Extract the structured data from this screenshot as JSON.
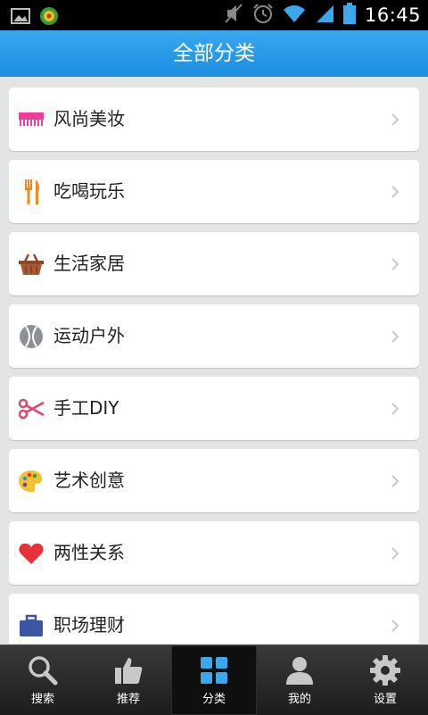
{
  "status_bar": {
    "time": "16:45",
    "icons": [
      "gallery-icon",
      "android-app-icon",
      "mute-icon",
      "alarm-icon",
      "wifi-icon",
      "signal-icon",
      "battery-icon"
    ]
  },
  "header": {
    "title": "全部分类"
  },
  "categories": [
    {
      "label": "风尚美妆",
      "icon": "comb-icon",
      "color": "#ee3d9b"
    },
    {
      "label": "吃喝玩乐",
      "icon": "fork-knife-icon",
      "color": "#f08a1d"
    },
    {
      "label": "生活家居",
      "icon": "basket-icon",
      "color": "#8a4a2a"
    },
    {
      "label": "运动户外",
      "icon": "ball-icon",
      "color": "#8d9196"
    },
    {
      "label": "手工DIY",
      "icon": "scissors-icon",
      "color": "#e0456a"
    },
    {
      "label": "艺术创意",
      "icon": "palette-icon",
      "color": "#f2c230"
    },
    {
      "label": "两性关系",
      "icon": "heart-icon",
      "color": "#e8323a"
    },
    {
      "label": "职场理财",
      "icon": "briefcase-icon",
      "color": "#3c55a4"
    }
  ],
  "tabbar": {
    "tabs": [
      {
        "label": "搜索",
        "icon": "search-icon"
      },
      {
        "label": "推荐",
        "icon": "thumbs-up-icon"
      },
      {
        "label": "分类",
        "icon": "grid-icon",
        "active": true
      },
      {
        "label": "我的",
        "icon": "user-icon"
      },
      {
        "label": "设置",
        "icon": "gear-icon"
      }
    ]
  }
}
